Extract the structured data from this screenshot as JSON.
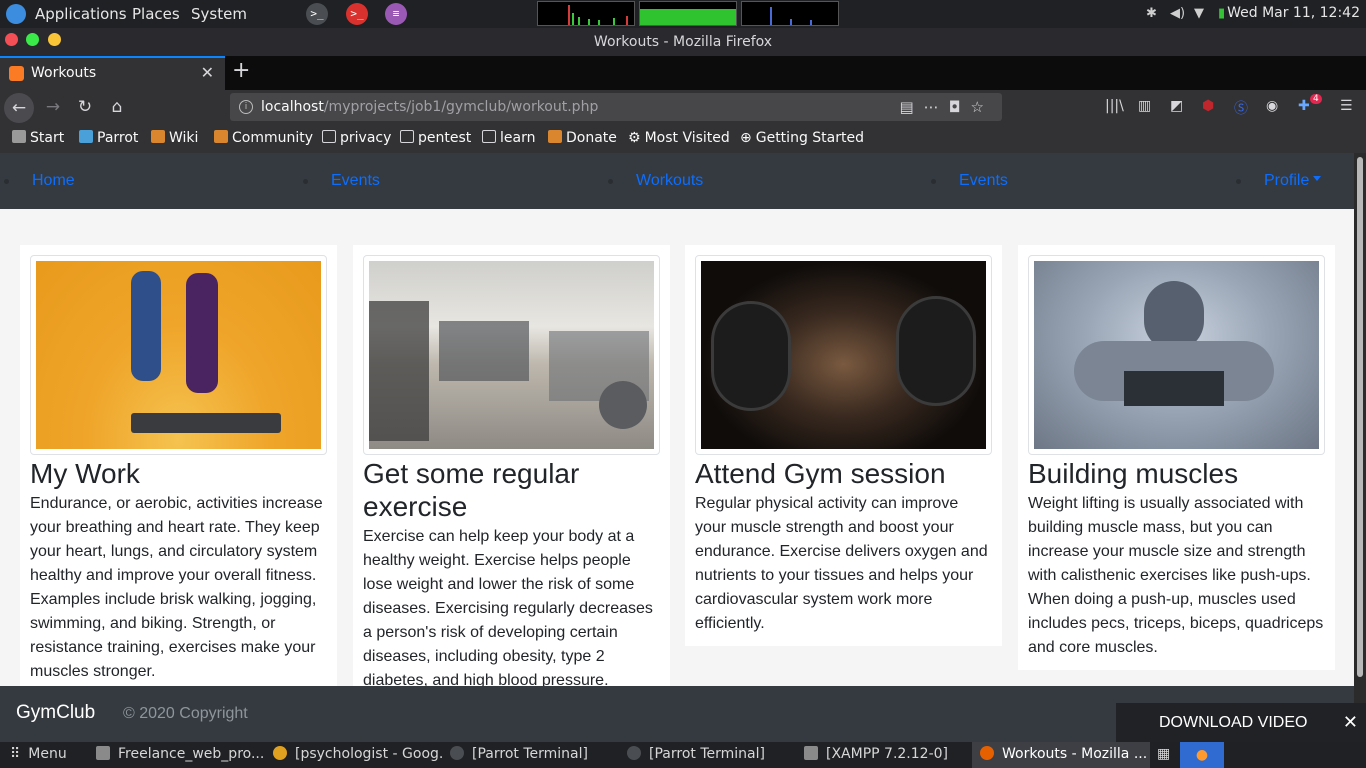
{
  "system_panel": {
    "menus": [
      "Applications",
      "Places",
      "System"
    ],
    "clock": "Wed Mar 11, 12:42"
  },
  "window": {
    "title": "Workouts - Mozilla Firefox"
  },
  "browser": {
    "tab_title": "Workouts",
    "url_host": "localhost",
    "url_path": "/myprojects/job1/gymclub/workout.php",
    "notification_badge": "4",
    "bookmarks": [
      "Start",
      "Parrot",
      "Wiki",
      "Community",
      "privacy",
      "pentest",
      "learn",
      "Donate",
      "Most Visited",
      "Getting Started"
    ]
  },
  "site": {
    "nav": [
      "Home",
      "Events",
      "Workouts",
      "Events",
      "Profile"
    ],
    "cards": [
      {
        "title": "My Work",
        "text": "Endurance, or aerobic, activities increase your breathing and heart rate. They keep your heart, lungs, and circulatory system healthy and improve your overall fitness. Examples include brisk walking, jogging, swimming, and biking. Strength, or resistance training, exercises make your muscles stronger."
      },
      {
        "title": "Get some regular exercise",
        "text": "Exercise can help keep your body at a healthy weight. Exercise helps people lose weight and lower the risk of some diseases. Exercising regularly decreases a person's risk of developing certain diseases, including obesity, type 2 diabetes, and high blood pressure."
      },
      {
        "title": "Attend Gym session",
        "text": "Regular physical activity can improve your muscle strength and boost your endurance. Exercise delivers oxygen and nutrients to your tissues and helps your cardiovascular system work more efficiently."
      },
      {
        "title": "Building muscles",
        "text": "Weight lifting is usually associated with building muscle mass, but you can increase your muscle size and strength with calisthenic exercises like push-ups. When doing a push-up, muscles used includes pecs, triceps, biceps, quadriceps and core muscles."
      }
    ],
    "footer_brand": "GymClub",
    "footer_copy": "© 2020 Copyright",
    "download_video": "DOWNLOAD VIDEO"
  },
  "taskbar": {
    "menu": "Menu",
    "items": [
      "Freelance_web_pro...",
      "[psychologist - Goog...",
      "[Parrot Terminal]",
      "[Parrot Terminal]",
      "[XAMPP 7.2.12-0]",
      "Workouts - Mozilla ..."
    ]
  },
  "colors": {
    "link": "#0d6efd",
    "nav_bg": "#343a40",
    "firefox_accent": "#0a84ff"
  }
}
